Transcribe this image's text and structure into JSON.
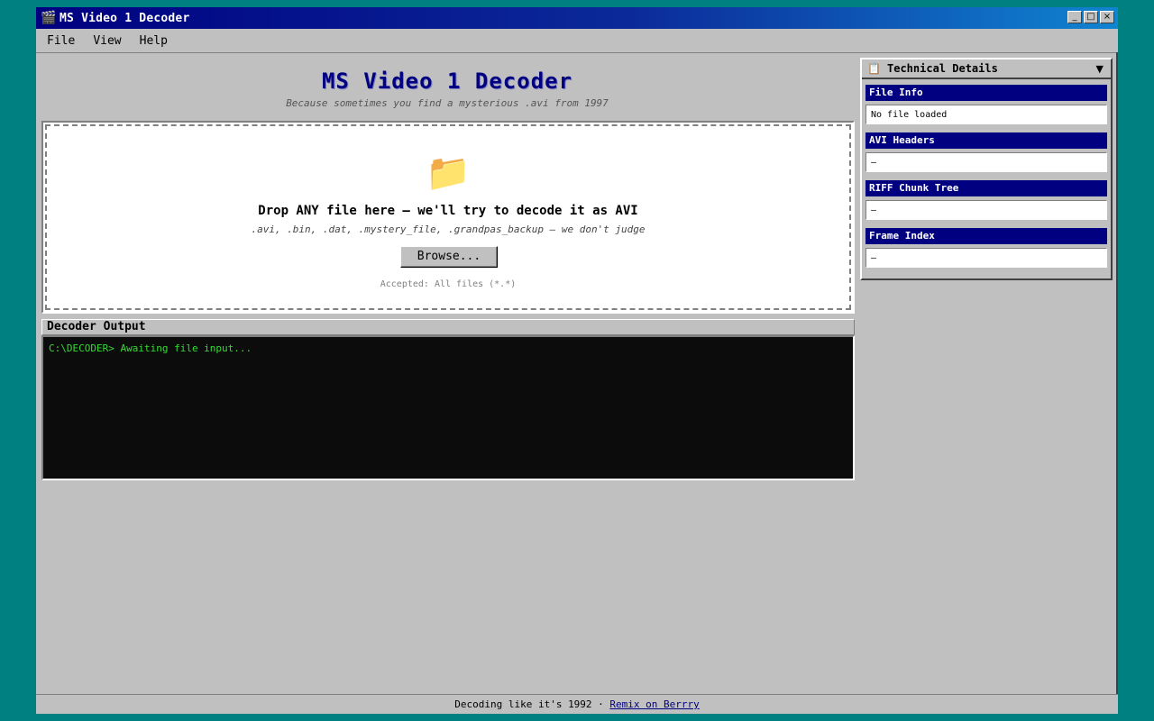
{
  "window": {
    "title": "MS Video 1 Decoder",
    "app_icon": "film-clapper-icon",
    "controls": {
      "minimize": "_",
      "maximize": "□",
      "close": "×"
    }
  },
  "menubar": {
    "items": [
      "File",
      "View",
      "Help"
    ]
  },
  "header": {
    "title": "MS Video 1 Decoder",
    "subtitle": "Because sometimes you find a mysterious .avi from 1997"
  },
  "dropzone": {
    "icon": "folder-icon",
    "icon_glyph": "📁",
    "title": "Drop ANY file here — we'll try to decode it as AVI",
    "subtitle": ".avi, .bin, .dat, .mystery_file, .grandpas_backup — we don't judge",
    "browse_label": "Browse...",
    "accepted": "Accepted: All files (*.*)"
  },
  "output": {
    "label": "Decoder Output",
    "lines": [
      "C:\\DECODER> Awaiting file input..."
    ]
  },
  "details_panel": {
    "icon": "clipboard-icon",
    "icon_glyph": "📋",
    "title": "Technical Details",
    "collapse_arrow": "▼",
    "sections": [
      {
        "title": "File Info",
        "value": "No file loaded"
      },
      {
        "title": "AVI Headers",
        "value": "—"
      },
      {
        "title": "RIFF Chunk Tree",
        "value": "—"
      },
      {
        "title": "Frame Index",
        "value": "—"
      }
    ]
  },
  "status": {
    "text": "Decoding like it's 1992 · ",
    "link": "Remix on Berrry"
  },
  "colors": {
    "desktop": "#008080",
    "window_face": "#c0c0c0",
    "title_bar": "#000080",
    "accent_navy": "#000080",
    "console_bg": "#0c0c0c",
    "console_text": "#33dd33"
  }
}
